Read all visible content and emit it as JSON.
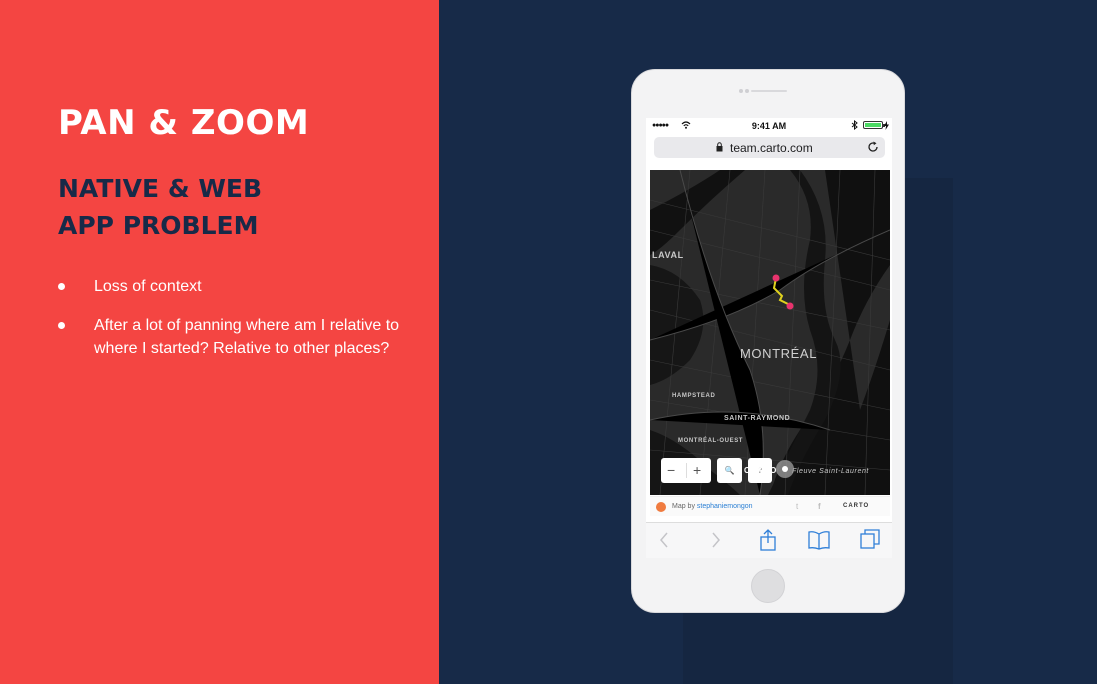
{
  "slide": {
    "title": "PAN & ZOOM",
    "subtitle_line1": "NATIVE & WEB",
    "subtitle_line2": "APP PROBLEM",
    "bullets": [
      "Loss of context",
      "After a lot of panning where am I relative to where I started? Relative to other places?"
    ],
    "colors": {
      "left_bg": "#f44542",
      "right_bg": "#172a48",
      "title": "#ffffff",
      "subtitle": "#172a48"
    }
  },
  "phone": {
    "status": {
      "time": "9:41 AM",
      "signal_icon": "signal-dots-icon",
      "wifi_icon": "wifi-icon",
      "bluetooth_icon": "bluetooth-icon",
      "battery_icon": "battery-icon"
    },
    "url": "team.carto.com",
    "map": {
      "labels": {
        "laval": "LAVAL",
        "montreal": "MONTRÉAL",
        "hampstead": "HAMPSTEAD",
        "saint_raymond": "SAINT-RAYMOND",
        "montreal_ouest": "MONTRÉAL-OUEST",
        "saint_laurent": "Fleuve Saint-Laurent"
      },
      "controls": {
        "zoom_out": "−",
        "zoom_in": "+",
        "search": "🔍",
        "help": "?"
      },
      "overlay_logo": "CARTO",
      "route_color": "#e0d21e",
      "marker_color": "#e8336d"
    },
    "attribution": {
      "prefix": "Map by ",
      "user": "stephaniemongon",
      "twitter": "t",
      "facebook": "f",
      "logo": "CARTO"
    },
    "toolbar": [
      "back-icon",
      "forward-icon",
      "share-icon",
      "bookmarks-icon",
      "tabs-icon"
    ]
  }
}
